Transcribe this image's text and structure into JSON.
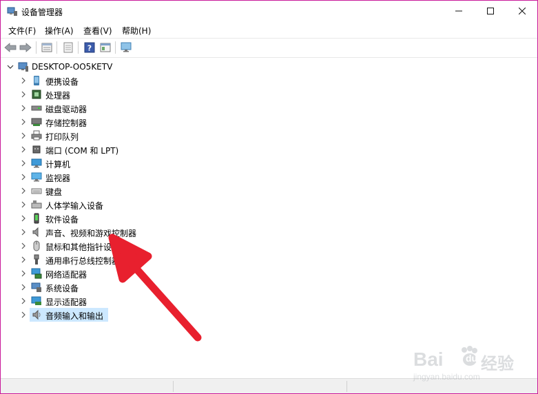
{
  "window": {
    "title": "设备管理器",
    "controls": {
      "minimize": "minimize",
      "maximize": "maximize",
      "close": "close"
    }
  },
  "menu": [
    "文件(F)",
    "操作(A)",
    "查看(V)",
    "帮助(H)"
  ],
  "toolbar": {
    "buttons": [
      "back-arrow-icon",
      "forward-arrow-icon",
      "properties-icon",
      "list-icon",
      "help-icon",
      "view-icon",
      "monitor-icon"
    ]
  },
  "tree": {
    "root": "DESKTOP-OO5KETV",
    "items": [
      {
        "label": "便携设备",
        "icon": "portable-device-icon"
      },
      {
        "label": "处理器",
        "icon": "processor-icon"
      },
      {
        "label": "磁盘驱动器",
        "icon": "disk-drive-icon"
      },
      {
        "label": "存储控制器",
        "icon": "storage-controller-icon"
      },
      {
        "label": "打印队列",
        "icon": "printer-icon"
      },
      {
        "label": "端口 (COM 和 LPT)",
        "icon": "port-icon"
      },
      {
        "label": "计算机",
        "icon": "computer-icon"
      },
      {
        "label": "监视器",
        "icon": "monitor-icon"
      },
      {
        "label": "键盘",
        "icon": "keyboard-icon"
      },
      {
        "label": "人体学输入设备",
        "icon": "hid-icon"
      },
      {
        "label": "软件设备",
        "icon": "software-device-icon"
      },
      {
        "label": "声音、视频和游戏控制器",
        "icon": "speaker-icon"
      },
      {
        "label": "鼠标和其他指针设备",
        "icon": "mouse-icon"
      },
      {
        "label": "通用串行总线控制器",
        "icon": "usb-icon"
      },
      {
        "label": "网络适配器",
        "icon": "network-adapter-icon"
      },
      {
        "label": "系统设备",
        "icon": "system-device-icon"
      },
      {
        "label": "显示适配器",
        "icon": "display-adapter-icon"
      },
      {
        "label": "音频输入和输出",
        "icon": "audio-io-icon",
        "selected": true
      }
    ]
  },
  "watermark": {
    "brand": "Bai",
    "brand2": "du",
    "brand3": "经验",
    "url": "jingyan.baidu.com"
  },
  "colors": {
    "accent": "#c8189a",
    "selection": "#cce8ff",
    "arrow": "#e8202e"
  }
}
